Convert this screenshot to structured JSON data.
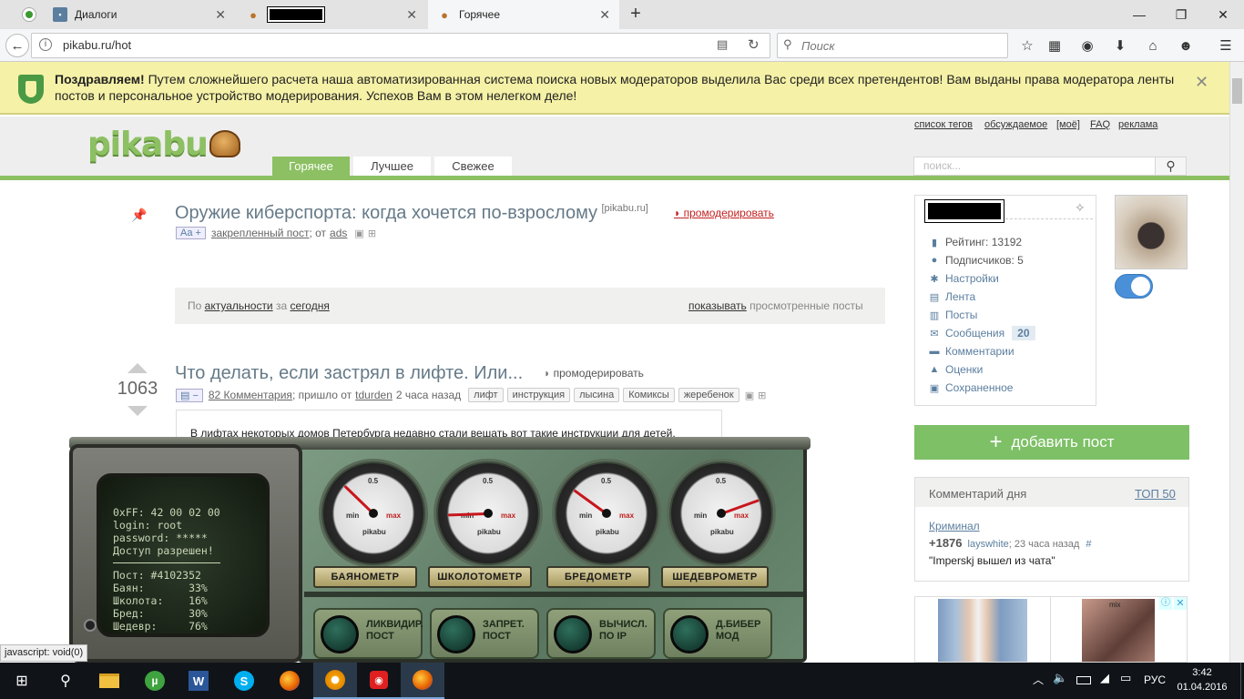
{
  "browser": {
    "tabs": [
      {
        "label": "Диалоги",
        "icon": "chat-icon"
      },
      {
        "label": "",
        "icon": "pikabu-icon",
        "redacted": true
      },
      {
        "label": "Горячее",
        "icon": "pikabu-icon"
      }
    ],
    "url": "pikabu.ru/hot",
    "search_placeholder": "Поиск",
    "status_text": "javascript: void(0)"
  },
  "notice": {
    "bold": "Поздравляем!",
    "text": " Путем сложнейшего расчета наша автоматизированная система поиска новых модераторов выделила Вас среди всех претендентов! Вам выданы права модератора ленты постов и персональное устройство модерирования. Успехов Вам в этом нелегком деле!"
  },
  "header": {
    "logo": "pikabu",
    "top_links": [
      "список тегов",
      "обсуждаемое",
      "[моё]",
      "FAQ",
      "реклама"
    ],
    "tabs": [
      "Горячее",
      "Лучшее",
      "Свежее"
    ],
    "search_placeholder": "поиск..."
  },
  "pinned_post": {
    "title": "Оружие киберспорта: когда хочется по-взрослому",
    "source": "[pikabu.ru]",
    "moderate": "промодерировать",
    "font_badge": "Aa +",
    "pinned_label": "закрепленный пост",
    "from_label": "; от",
    "author": "ads"
  },
  "filter_bar": {
    "prefix": "По",
    "sort": "актуальности",
    "middle": "за",
    "period": "сегодня",
    "show": "показывать",
    "viewed": "просмотренные посты"
  },
  "post": {
    "rating": "1063",
    "title": "Что делать, если застрял в лифте. Или...",
    "moderate": "промодерировать",
    "comments": "82 Комментария",
    "came_from": "; пришло от",
    "author": "tdurden",
    "time": "2 часа назад",
    "tags": [
      "лифт",
      "инструкция",
      "лысина",
      "Комиксы",
      "жеребенок"
    ],
    "body": "В лифтах некоторых домов Петербурга недавно стали вешать вот такие инструкции для детей,"
  },
  "machine": {
    "screen_lines": [
      "0xFF: 42 00 02 00",
      "login: root",
      "password: *****",
      "Доступ разрешен!",
      "Пост: #4102352",
      "Баян:       33%",
      "Школота:    16%",
      "Бред:       30%",
      "Шедевр:     76%"
    ],
    "gauges": [
      {
        "label": "БАЯНОМЕТР",
        "level": 0.33
      },
      {
        "label": "ШКОЛОТОМЕТР",
        "level": 0.16
      },
      {
        "label": "БРЕДОМЕТР",
        "level": 0.3
      },
      {
        "label": "ШЕДЕВРОМЕТР",
        "level": 0.76
      }
    ],
    "gauge_marks": {
      "mid": "0.5",
      "min": "min",
      "max": "max",
      "brand": "pikabu"
    },
    "buttons": [
      {
        "line1": "ЛИКВИДИР.",
        "line2": "ПОСТ"
      },
      {
        "line1": "ЗАПРЕТ.",
        "line2": "ПОСТ"
      },
      {
        "line1": "ВЫЧИСЛ.",
        "line2": "ПО IP"
      },
      {
        "line1": "Д.БИБЕР",
        "line2": "МОД"
      }
    ]
  },
  "sidebar": {
    "profile": {
      "items": [
        {
          "icon": "rating-icon",
          "label": "Рейтинг: 13192"
        },
        {
          "icon": "user-icon",
          "label": "Подписчиков: 5"
        },
        {
          "icon": "gear-icon",
          "label": "Настройки"
        },
        {
          "icon": "feed-icon",
          "label": "Лента"
        },
        {
          "icon": "posts-icon",
          "label": "Посты"
        },
        {
          "icon": "mail-icon",
          "label": "Сообщения",
          "badge": "20"
        },
        {
          "icon": "comment-icon",
          "label": "Комментарии"
        },
        {
          "icon": "rate-icon",
          "label": "Оценки"
        },
        {
          "icon": "save-icon",
          "label": "Сохраненное"
        }
      ]
    },
    "add_post": "добавить пост",
    "comment_of_day": {
      "title": "Комментарий дня",
      "top": "ТОП 50",
      "post": "Криминал",
      "score": "+1876",
      "author": "layswhite",
      "time": "; 23 часа назад",
      "hash": "#",
      "quote": "\"Imperskj вышел из чата\""
    },
    "ad_text": "mix"
  },
  "taskbar": {
    "lang": "РУС",
    "time": "3:42",
    "date": "01.04.2016"
  },
  "colors": {
    "green": "#8cc062",
    "link": "#5b7e9f",
    "notice": "#f5f1a7"
  }
}
